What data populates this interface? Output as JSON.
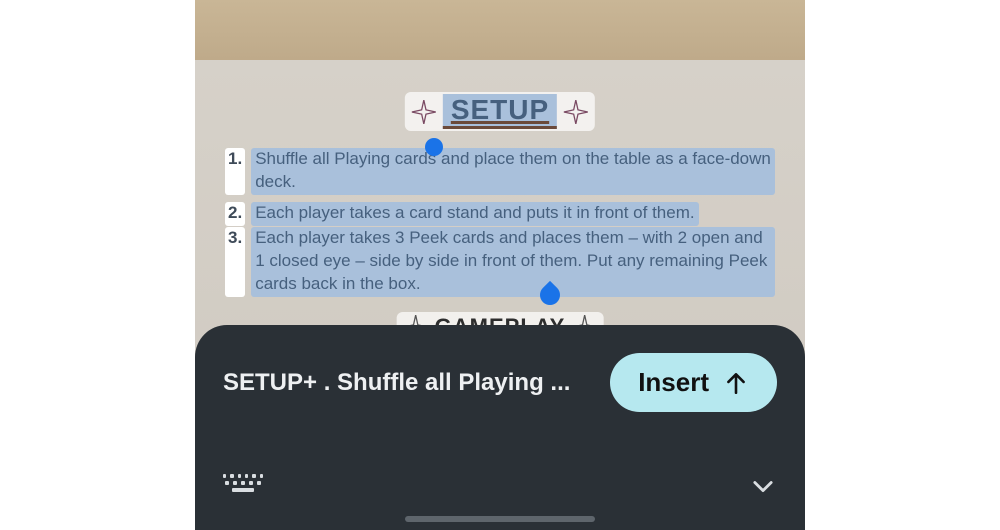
{
  "section_title": "SETUP",
  "next_section_title": "GAMEPLAY",
  "instructions": {
    "i1": {
      "num": "1.",
      "text": "Shuffle all Playing cards and place them on the table as a face-down deck."
    },
    "i2": {
      "num": "2.",
      "text": "Each player takes a card stand and puts it in front of them."
    },
    "i3": {
      "num": "3.",
      "text": "Each player takes 3 Peek cards and places them – with 2 open and 1 closed eye – side by side in front of them. Put any remaining Peek cards back in the box."
    }
  },
  "sheet": {
    "recognized_text": "SETUP+ . Shuffle all Playing ...",
    "insert_label": "Insert"
  }
}
